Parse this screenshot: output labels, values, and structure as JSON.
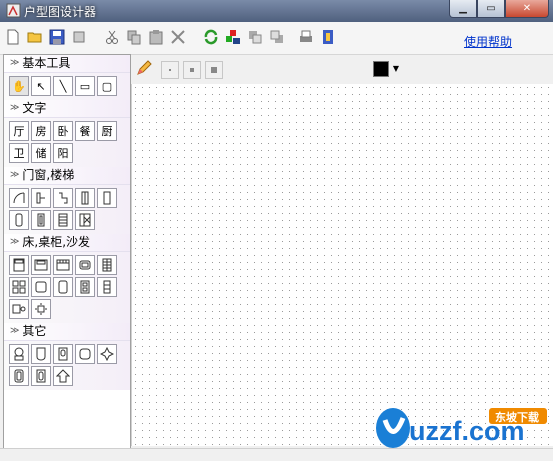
{
  "window": {
    "title": "户型图设计器",
    "min_icon": "minimize-icon",
    "max_icon": "maximize-icon",
    "close_icon": "close-icon"
  },
  "toolbar": {
    "help_label": "使用帮助",
    "icons": [
      "new-file-icon",
      "open-folder-icon",
      "save-icon",
      "print-preview-icon",
      "cut-icon",
      "copy-icon",
      "paste-icon",
      "delete-icon",
      "refresh-icon",
      "layers-icon",
      "move-back-icon",
      "move-front-icon",
      "print-icon",
      "export-icon"
    ]
  },
  "panel": {
    "sections": [
      {
        "title": "基本工具",
        "tools": [
          "✋",
          "↖",
          "╲",
          "▭",
          "▢"
        ]
      },
      {
        "title": "文字",
        "tools": [
          "厅",
          "房",
          "卧",
          "餐",
          "厨",
          "卫",
          "储",
          "阳"
        ]
      },
      {
        "title": "门窗,楼梯",
        "tools": [
          "door-arc",
          "door-left",
          "door-right",
          "window-single",
          "window-double",
          "window-tall",
          "window-narrow",
          "stair",
          "stair-window"
        ]
      },
      {
        "title": "床,桌柜,沙发",
        "tools": [
          "bed",
          "cabinet",
          "cabinet-b",
          "sofa",
          "bookshelf",
          "table-chairs",
          "square-table",
          "round-table",
          "double-bed",
          "tall-cabinet",
          "single-desk",
          "dining-set"
        ]
      },
      {
        "title": "其它",
        "tools": [
          "toilet",
          "bathtub",
          "basin",
          "washer",
          "plant",
          "fridge",
          "cooker",
          "arrow-up"
        ]
      }
    ]
  },
  "canvas_toolbar": {
    "pencil_icon": "pencil-icon",
    "color_value": "#000000"
  },
  "watermark": {
    "text": "uzzf.com",
    "badge": "东坡下载"
  }
}
